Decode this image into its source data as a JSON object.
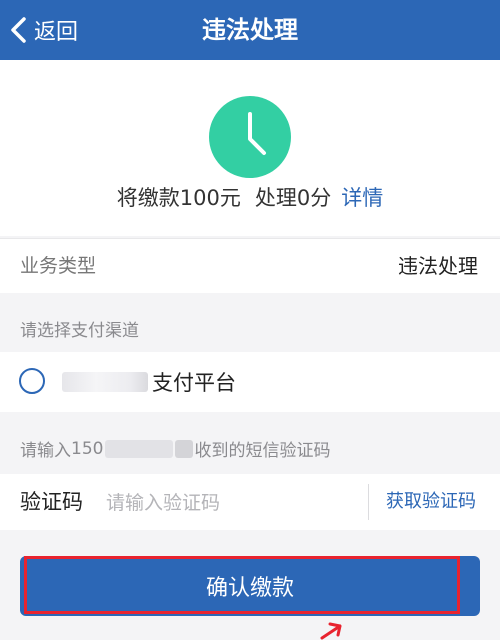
{
  "header": {
    "back_label": "返回",
    "title": "违法处理"
  },
  "summary": {
    "text_fine": "将缴款100元",
    "text_points": "处理0分",
    "detail_link": "详情",
    "icon": "clock-icon",
    "icon_color": "#33cfa3"
  },
  "business": {
    "label": "业务类型",
    "value": "违法处理"
  },
  "payment": {
    "section_label": "请选择支付渠道",
    "option_label": "支付平台",
    "selected": false
  },
  "sms": {
    "hint_prefix": "请输入",
    "hint_partial": "150",
    "hint_suffix": "收到的短信验证码"
  },
  "code": {
    "label": "验证码",
    "placeholder": "请输入验证码",
    "value": "",
    "get_code_label": "获取验证码"
  },
  "confirm_label": "确认缴款",
  "colors": {
    "primary": "#2c67b6",
    "highlight": "#e8232f",
    "accent": "#33cfa3"
  }
}
